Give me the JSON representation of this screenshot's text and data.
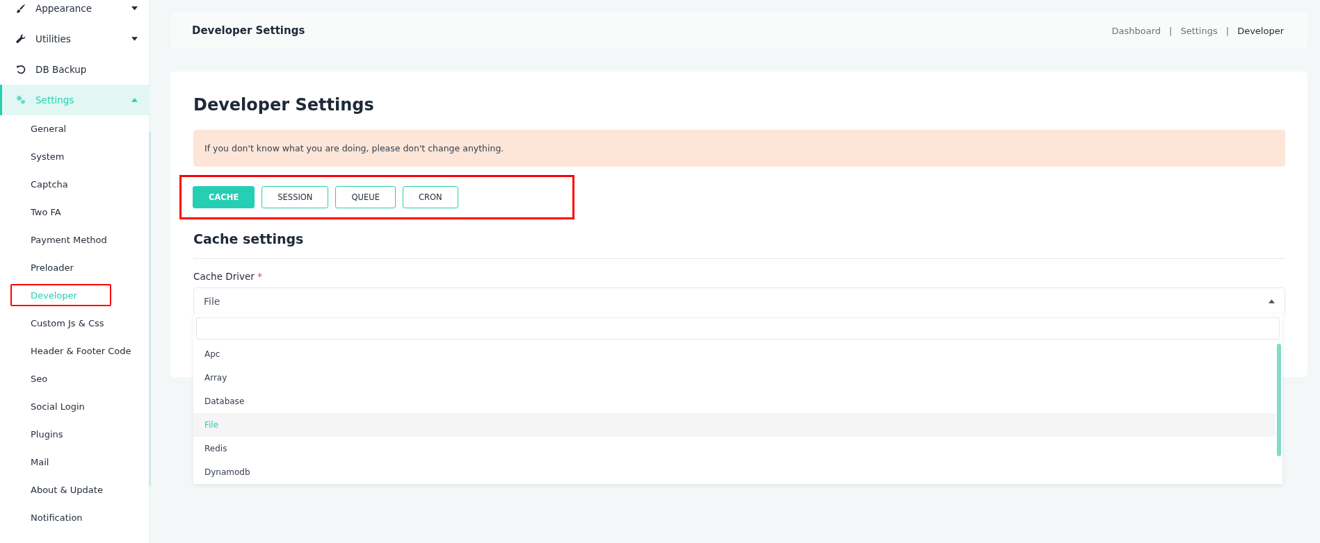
{
  "sidebar": {
    "items": [
      {
        "label": "Appearance",
        "expanded": false,
        "selected": false
      },
      {
        "label": "Utilities",
        "expanded": false,
        "selected": false
      },
      {
        "label": "DB Backup",
        "selected": false
      },
      {
        "label": "Settings",
        "expanded": true,
        "selected": true,
        "children": [
          {
            "label": "General",
            "selected": false,
            "highlighted": false
          },
          {
            "label": "System",
            "selected": false,
            "highlighted": false
          },
          {
            "label": "Captcha",
            "selected": false,
            "highlighted": false
          },
          {
            "label": "Two FA",
            "selected": false,
            "highlighted": false
          },
          {
            "label": "Payment Method",
            "selected": false,
            "highlighted": false
          },
          {
            "label": "Preloader",
            "selected": false,
            "highlighted": false
          },
          {
            "label": "Developer",
            "selected": true,
            "highlighted": true
          },
          {
            "label": "Custom Js & Css",
            "selected": false,
            "highlighted": false
          },
          {
            "label": "Header & Footer Code",
            "selected": false,
            "highlighted": false
          },
          {
            "label": "Seo",
            "selected": false,
            "highlighted": false
          },
          {
            "label": "Social Login",
            "selected": false,
            "highlighted": false
          },
          {
            "label": "Plugins",
            "selected": false,
            "highlighted": false
          },
          {
            "label": "Mail",
            "selected": false,
            "highlighted": false
          },
          {
            "label": "About & Update",
            "selected": false,
            "highlighted": false
          },
          {
            "label": "Notification",
            "selected": false,
            "highlighted": false
          }
        ]
      }
    ]
  },
  "header": {
    "title": "Developer Settings",
    "breadcrumb": [
      {
        "label": "Dashboard",
        "current": false
      },
      {
        "label": "Settings",
        "current": false
      },
      {
        "label": "Developer",
        "current": true
      }
    ],
    "separator": "|"
  },
  "page": {
    "title": "Developer Settings",
    "alert": "If you don't know what you are doing, please don't change anything.",
    "tabs": {
      "highlighted": true,
      "items": [
        {
          "label": "CACHE",
          "selected": true
        },
        {
          "label": "SESSION",
          "selected": false
        },
        {
          "label": "QUEUE",
          "selected": false
        },
        {
          "label": "CRON",
          "selected": false
        }
      ]
    },
    "section_title": "Cache settings",
    "field": {
      "label": "Cache Driver",
      "required_mark": "*",
      "value": "File",
      "expanded": true,
      "options": [
        {
          "label": "Apc",
          "selected": false
        },
        {
          "label": "Array",
          "selected": false
        },
        {
          "label": "Database",
          "selected": false
        },
        {
          "label": "File",
          "selected": true
        },
        {
          "label": "Redis",
          "selected": false
        },
        {
          "label": "Dynamodb",
          "selected": false
        }
      ]
    }
  }
}
